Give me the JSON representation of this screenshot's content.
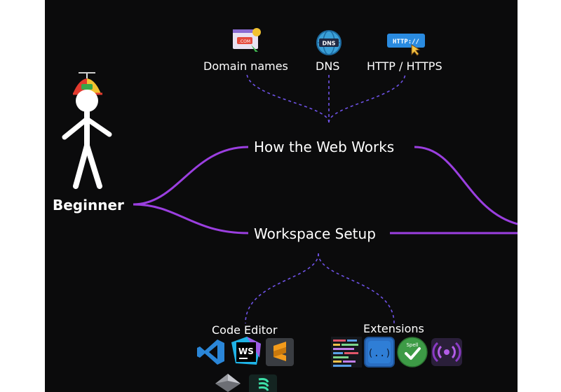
{
  "root": {
    "label": "Beginner"
  },
  "branches": [
    {
      "label": "How the Web Works",
      "children": [
        {
          "label": "Domain names",
          "icon": "domain-icon"
        },
        {
          "label": "DNS",
          "icon": "dns-globe-icon"
        },
        {
          "label": "HTTP / HTTPS",
          "icon": "http-icon"
        }
      ]
    },
    {
      "label": "Workspace Setup",
      "children": [
        {
          "label": "Code Editor",
          "icons": [
            "vscode-icon",
            "webstorm-icon",
            "sublime-text-icon",
            "atom-icon",
            "brackets-icon"
          ]
        },
        {
          "label": "Extensions",
          "icons": [
            "code-minimap-icon",
            "bracket-pair-icon",
            "spell-check-icon",
            "live-server-icon"
          ]
        }
      ]
    }
  ],
  "icon_text": {
    "domain": ".COM",
    "http": "HTTP://",
    "dns": "DNS",
    "webstorm": "WS",
    "spell": "Spell"
  },
  "colors": {
    "background": "#0b0b0c",
    "branch_line": "#9b3fe0",
    "dashed_line": "#6e52e6",
    "text": "#ffffff"
  }
}
